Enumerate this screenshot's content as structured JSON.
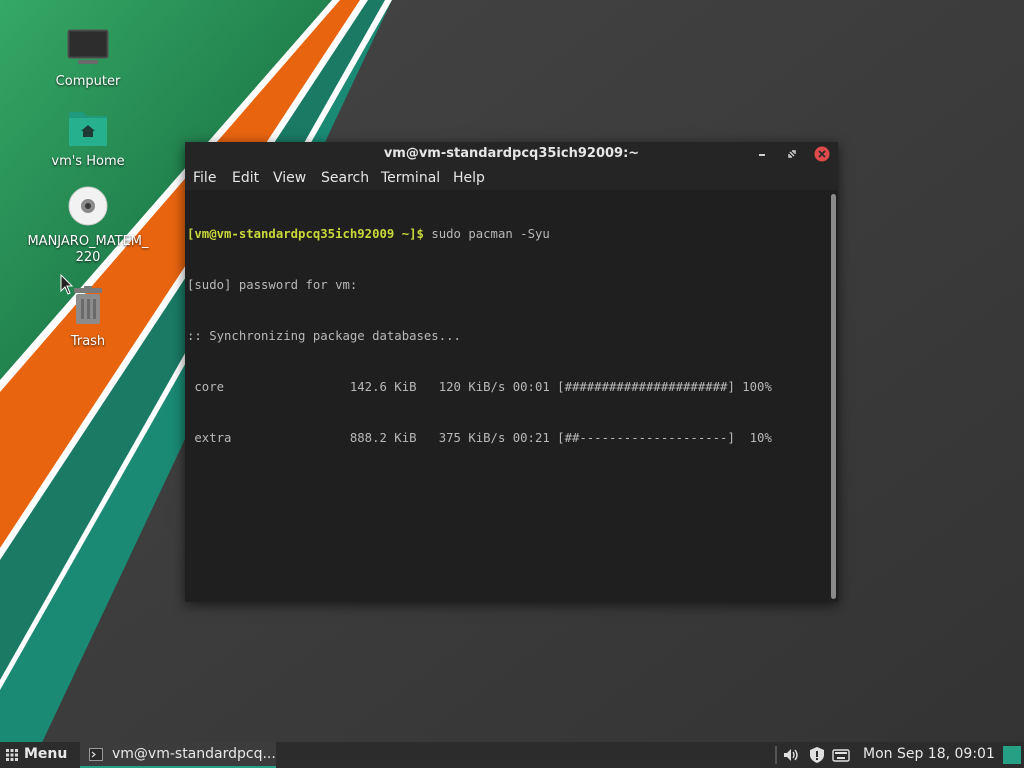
{
  "desktop": {
    "icons": [
      {
        "label": "Computer",
        "icon": "computer-icon"
      },
      {
        "label": "vm's Home",
        "icon": "home-folder-icon"
      },
      {
        "label": "MANJARO_MATEM_\n220",
        "icon": "optical-disc-icon"
      },
      {
        "label": "Trash",
        "icon": "trash-icon"
      }
    ]
  },
  "terminal": {
    "title": "vm@vm-standardpcq35ich92009:~",
    "menu": [
      "File",
      "Edit",
      "View",
      "Search",
      "Terminal",
      "Help"
    ],
    "prompt": "[vm@vm-standardpcq35ich92009 ~]$",
    "command": " sudo pacman -Syu",
    "lines": [
      "[sudo] password for vm:",
      ":: Synchronizing package databases...",
      " core                 142.6 KiB   120 KiB/s 00:01 [######################] 100%",
      " extra                888.2 KiB   375 KiB/s 00:21 [##--------------------]  10%"
    ],
    "downloads": [
      {
        "repo": "core",
        "size": "142.6 KiB",
        "rate": "120 KiB/s",
        "time": "00:01",
        "progress": 1.0
      },
      {
        "repo": "extra",
        "size": "888.2 KiB",
        "rate": "375 KiB/s",
        "time": "00:21",
        "progress": 0.1
      }
    ]
  },
  "taskbar": {
    "menu_label": "Menu",
    "task_label": "vm@vm-standardpcq...",
    "clock": "Mon Sep 18, 09:01",
    "tray_icons": [
      "volume-icon",
      "security-update-icon",
      "keyboard-icon"
    ]
  },
  "colors": {
    "accent": "#26a085",
    "prompt": "#c9d83a",
    "close_button": "#e04a4a",
    "stripe_green": "#1a8a5a",
    "stripe_orange": "#e8640f",
    "stripe_teal": "#1a7a64"
  }
}
